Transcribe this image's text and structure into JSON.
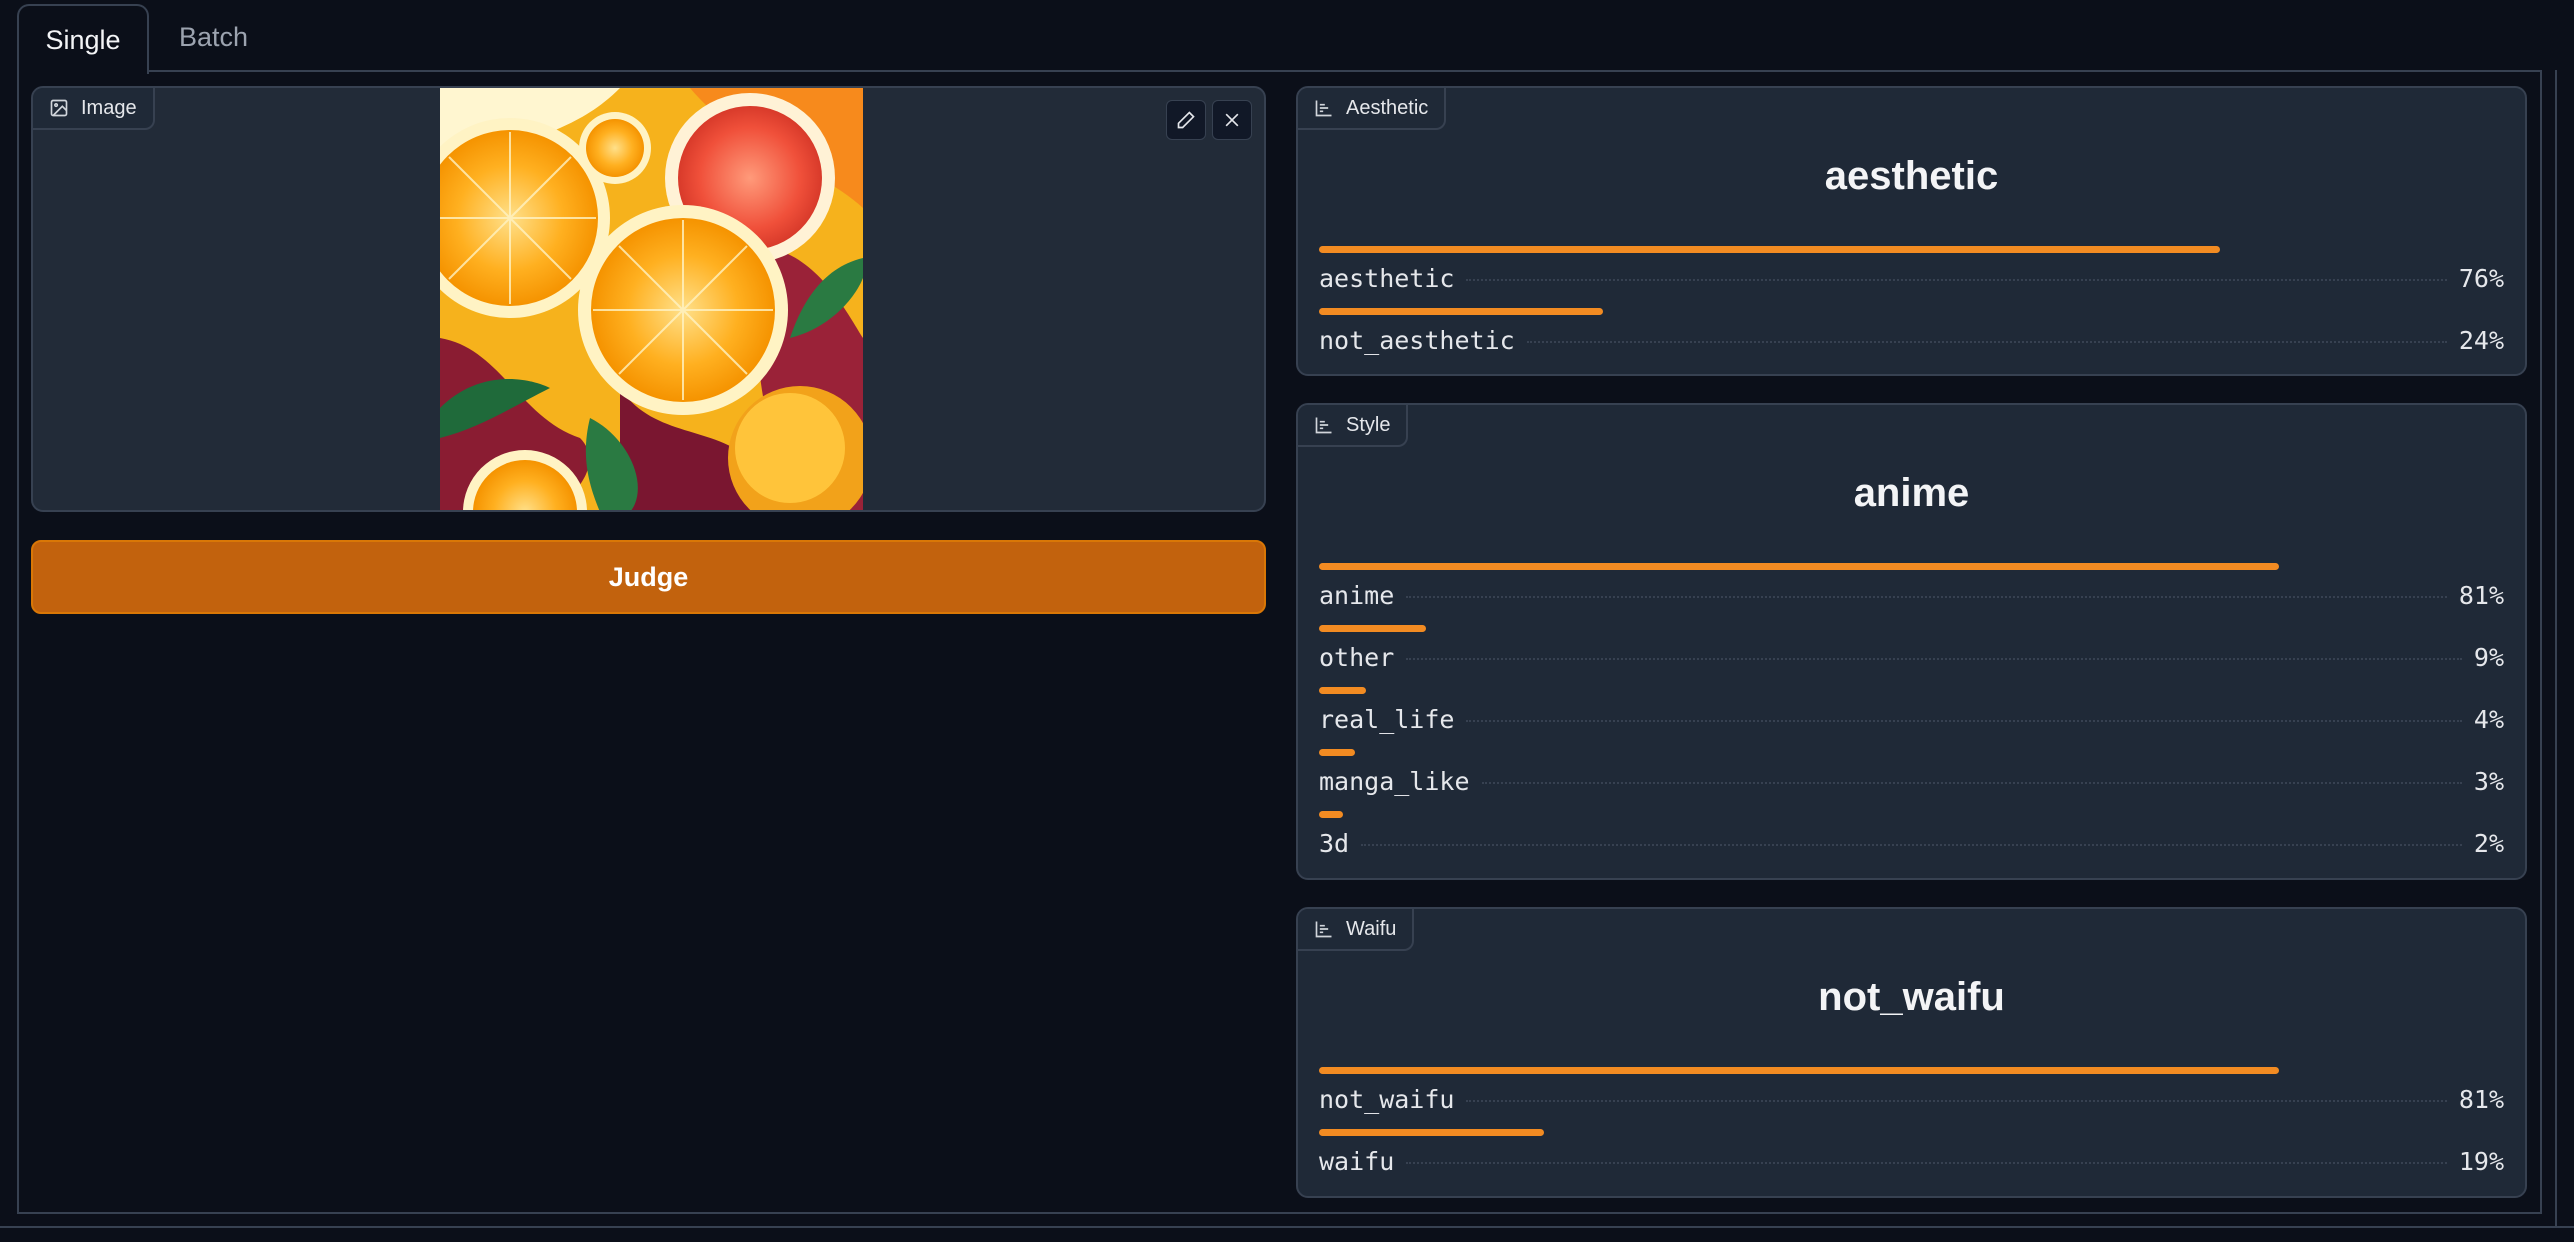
{
  "tabs": [
    {
      "label": "Single",
      "active": true
    },
    {
      "label": "Batch",
      "active": false
    }
  ],
  "image_block": {
    "label": "Image",
    "icon": "image-icon",
    "actions": [
      "edit-icon",
      "close-icon"
    ]
  },
  "judge_button": {
    "label": "Judge",
    "color": "#c2620d"
  },
  "accent_color": "#f28b22",
  "panels": [
    {
      "label": "Aesthetic",
      "title": "aesthetic",
      "rows": [
        {
          "name": "aesthetic",
          "pct": "76%",
          "value": 0.76
        },
        {
          "name": "not_aesthetic",
          "pct": "24%",
          "value": 0.24
        }
      ]
    },
    {
      "label": "Style",
      "title": "anime",
      "rows": [
        {
          "name": "anime",
          "pct": "81%",
          "value": 0.81
        },
        {
          "name": "other",
          "pct": "9%",
          "value": 0.09
        },
        {
          "name": "real_life",
          "pct": "4%",
          "value": 0.04
        },
        {
          "name": "manga_like",
          "pct": "3%",
          "value": 0.03
        },
        {
          "name": "3d",
          "pct": "2%",
          "value": 0.02
        }
      ]
    },
    {
      "label": "Waifu",
      "title": "not_waifu",
      "rows": [
        {
          "name": "not_waifu",
          "pct": "81%",
          "value": 0.81
        },
        {
          "name": "waifu",
          "pct": "19%",
          "value": 0.19
        }
      ]
    }
  ]
}
